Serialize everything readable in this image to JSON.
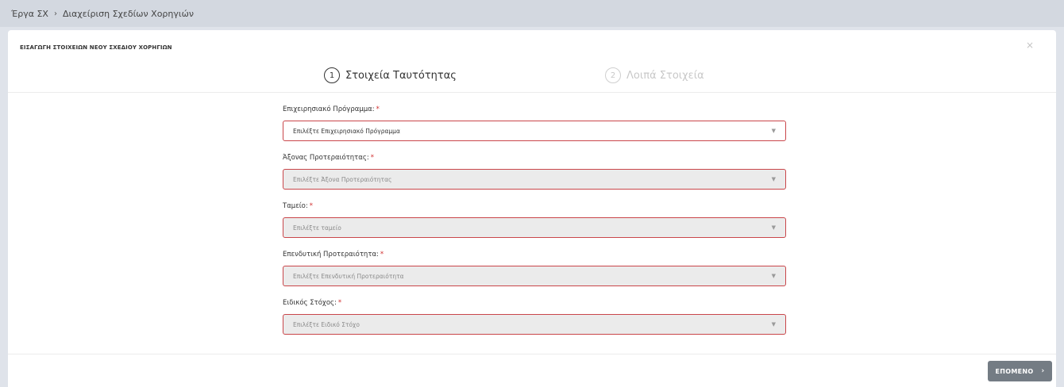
{
  "breadcrumb": {
    "root": "Έργα ΣΧ",
    "separator": "›",
    "current": "Διαχείριση Σχεδίων Χορηγιών"
  },
  "modal": {
    "title": "ΕΙΣΑΓΩΓΗ ΣΤΟΙΧΕΙΩΝ ΝΕΟΥ ΣΧΕΔΙΟΥ ΧΟΡΗΓΙΩΝ",
    "close_symbol": "×"
  },
  "steps": [
    {
      "number": "1",
      "label": "Στοιχεία Ταυτότητας",
      "active": true
    },
    {
      "number": "2",
      "label": "Λοιπά Στοιχεία",
      "active": false
    }
  ],
  "fields": [
    {
      "label": "Επιχειρησιακό Πρόγραμμα:",
      "required_mark": "*",
      "placeholder": "Επιλέξτε Επιχειρησιακό Πρόγραμμα",
      "enabled": true
    },
    {
      "label": "Άξονας Προτεραιότητας:",
      "required_mark": "*",
      "placeholder": "Επιλέξτε Άξονα Προτεραιότητας",
      "enabled": false
    },
    {
      "label": "Ταμείο:",
      "required_mark": "*",
      "placeholder": "Επιλέξτε ταμείο",
      "enabled": false
    },
    {
      "label": "Επενδυτική Προτεραιότητα:",
      "required_mark": "*",
      "placeholder": "Επιλέξτε Επενδυτική Προτεραιότητα",
      "enabled": false
    },
    {
      "label": "Ειδικός Στόχος:",
      "required_mark": "*",
      "placeholder": "Επιλέξτε Ειδικό Στόχο",
      "enabled": false
    }
  ],
  "icons": {
    "dropdown": "chevron-down-icon",
    "next": "chevron-right-icon",
    "close": "close-icon"
  },
  "footer": {
    "next_label": "ΕΠΟΜΕΝΟ",
    "next_arrow": "›"
  },
  "colors": {
    "required": "#d12f2f",
    "field_border": "#c9464a",
    "next_button": "#747c84"
  }
}
